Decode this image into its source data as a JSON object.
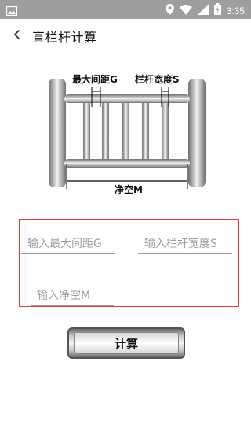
{
  "status_bar": {
    "time": "3:35",
    "icons": [
      "image-icon",
      "location-icon",
      "wifi-icon",
      "signal-icon",
      "battery-icon"
    ]
  },
  "app_bar": {
    "back_icon": "back-arrow-icon",
    "title": "直栏杆计算"
  },
  "diagram": {
    "label_max_gap": "最大间距G",
    "label_rail_width": "栏杆宽度S",
    "label_clear_span": "净空M"
  },
  "form": {
    "max_gap_placeholder": "输入最大间距G",
    "rail_width_placeholder": "输入栏杆宽度S",
    "clear_span_placeholder": "输入净空M",
    "border_color": "#e53935"
  },
  "calculate_button": {
    "label": "计算"
  }
}
